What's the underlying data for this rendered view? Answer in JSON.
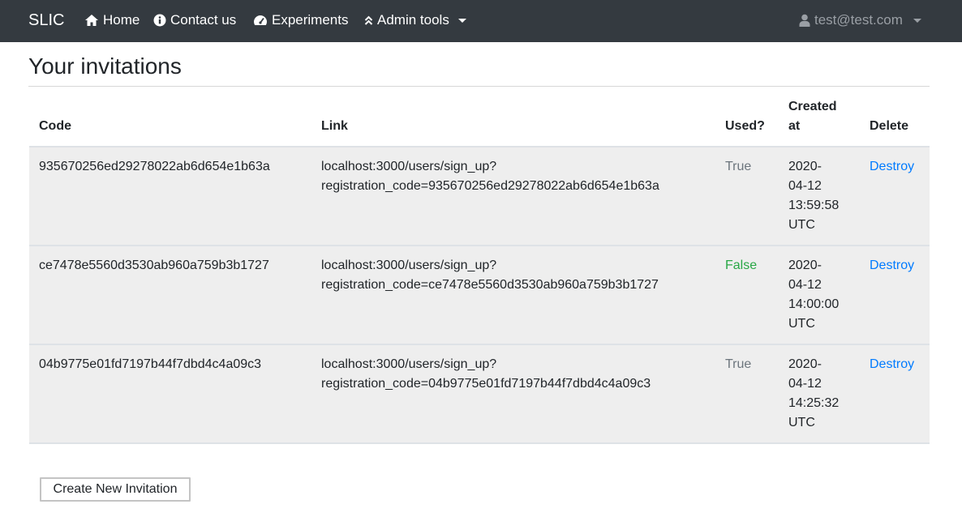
{
  "navbar": {
    "brand": "SLIC",
    "home": "Home",
    "contact": "Contact us",
    "experiments": "Experiments",
    "admin_tools": "Admin tools",
    "user": "test@test.com"
  },
  "page": {
    "title": "Your invitations"
  },
  "table": {
    "headers": {
      "code": "Code",
      "link": "Link",
      "used": "Used?",
      "created_line1": "Created",
      "created_line2": "at",
      "delete": "Delete"
    },
    "rows": [
      {
        "code": "935670256ed29278022ab6d654e1b63a",
        "link_line1": "localhost:3000/users/sign_up?",
        "link_line2": "registration_code=935670256ed29278022ab6d654e1b63a",
        "used": "True",
        "created_line1": "2020-",
        "created_line2": "04-12",
        "created_line3": "13:59:58",
        "created_line4": "UTC",
        "delete": "Destroy"
      },
      {
        "code": "ce7478e5560d3530ab960a759b3b1727",
        "link_line1": "localhost:3000/users/sign_up?",
        "link_line2": "registration_code=ce7478e5560d3530ab960a759b3b1727",
        "used": "False",
        "created_line1": "2020-",
        "created_line2": "04-12",
        "created_line3": "14:00:00",
        "created_line4": "UTC",
        "delete": "Destroy"
      },
      {
        "code": "04b9775e01fd7197b44f7dbd4c4a09c3",
        "link_line1": "localhost:3000/users/sign_up?",
        "link_line2": "registration_code=04b9775e01fd7197b44f7dbd4c4a09c3",
        "used": "True",
        "created_line1": "2020-",
        "created_line2": "04-12",
        "created_line3": "14:25:32",
        "created_line4": "UTC",
        "delete": "Destroy"
      }
    ]
  },
  "actions": {
    "create_label": "Create New Invitation"
  },
  "colors": {
    "navbar_bg": "#343a40",
    "link": "#007bff",
    "used_true": "#6c757d",
    "used_false": "#28a745",
    "row_bg": "#eeeeee"
  },
  "icons": {
    "home": "home-icon",
    "contact": "info-circle-icon",
    "experiments": "tachometer-icon",
    "admin_tools": "double-chevron-up-icon",
    "user": "user-icon",
    "dropdown": "caret-down-icon"
  }
}
